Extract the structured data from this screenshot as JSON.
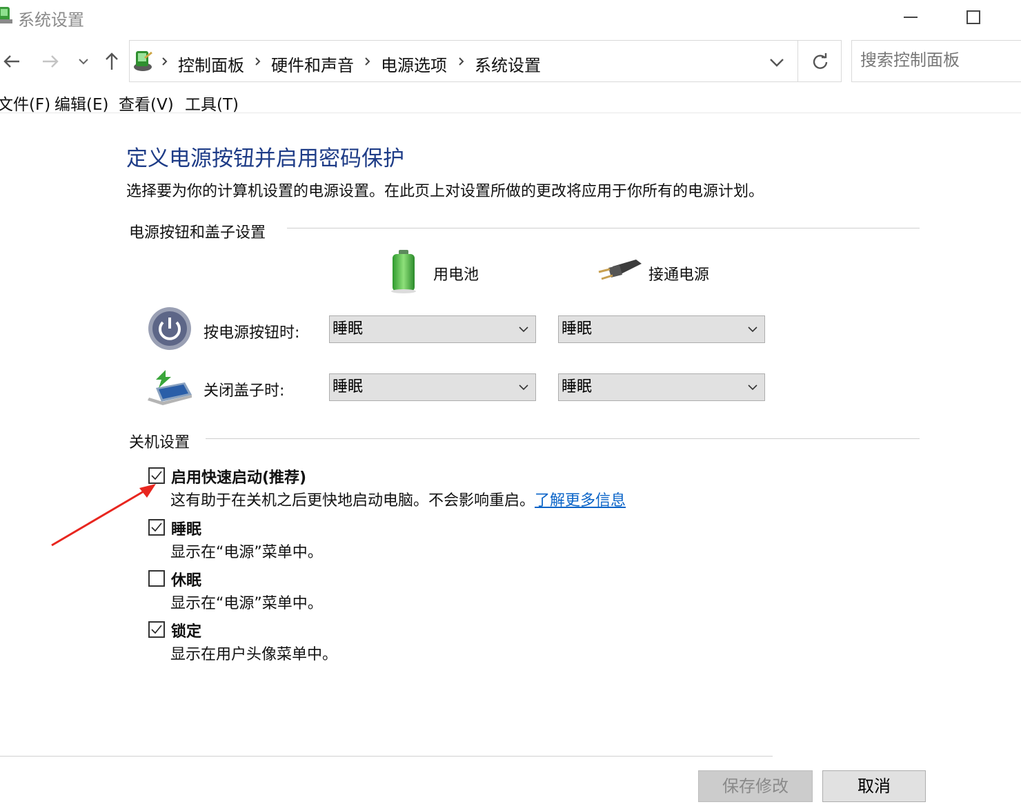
{
  "window": {
    "title": "系统设置"
  },
  "address": {
    "breadcrumbs": [
      "控制面板",
      "硬件和声音",
      "电源选项",
      "系统设置"
    ],
    "search_placeholder": "搜索控制面板"
  },
  "menu": [
    "文件(F)",
    "编辑(E)",
    "查看(V)",
    "工具(T)"
  ],
  "content": {
    "title": "定义电源按钮并启用密码保护",
    "description": "选择要为你的计算机设置的电源设置。在此页上对设置所做的更改将应用于你所有的电源计划。",
    "power_group": {
      "title": "电源按钮和盖子设置",
      "col_battery": "用电池",
      "col_plugged": "接通电源",
      "rows": [
        {
          "label": "按电源按钮时:",
          "battery": "睡眠",
          "plugged": "睡眠"
        },
        {
          "label": "关闭盖子时:",
          "battery": "睡眠",
          "plugged": "睡眠"
        }
      ]
    },
    "shutdown_group": {
      "title": "关机设置",
      "items": [
        {
          "label": "启用快速启动(推荐)",
          "desc": "这有助于在关机之后更快地启动电脑。不会影响重启。",
          "link": "了解更多信息",
          "checked": true
        },
        {
          "label": "睡眠",
          "desc": "显示在“电源”菜单中。",
          "checked": true
        },
        {
          "label": "休眠",
          "desc": "显示在“电源”菜单中。",
          "checked": false
        },
        {
          "label": "锁定",
          "desc": "显示在用户头像菜单中。",
          "checked": true
        }
      ]
    }
  },
  "buttons": {
    "save": "保存修改",
    "cancel": "取消"
  },
  "colors": {
    "title_blue": "#1e3c87",
    "link_blue": "#0a64c8",
    "annotation_arrow": "#e8261f"
  }
}
